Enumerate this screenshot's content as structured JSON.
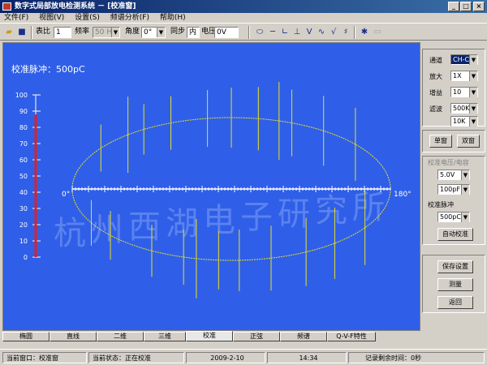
{
  "title": "数字式局部放电检测系统 － [校准窗]",
  "menu": [
    "文件(F)",
    "视图(V)",
    "设置(S)",
    "频谱分析(F)",
    "帮助(H)"
  ],
  "toolbar": {
    "biaobi_label": "表比",
    "biaobi_value": "1",
    "freq_label": "频率",
    "freq_value": "50 Hz",
    "angle_label": "角度",
    "angle_value": "0°",
    "sync_label": "同步",
    "sync_value": "内",
    "voltage_label": "电压",
    "voltage_value": "0V"
  },
  "scope": {
    "calib_title": "校准脉冲：500pC",
    "y_ticks": [
      "100",
      "90",
      "80",
      "70",
      "60",
      "50",
      "40",
      "30",
      "20",
      "10",
      "0"
    ],
    "left_angle": "0°",
    "right_angle": "180°",
    "watermark": "杭州西湖电子研究所",
    "level_bar_fraction": 0.88
  },
  "panel": {
    "channel_label": "通道",
    "channel_value": "CH-C",
    "gain_label": "放大",
    "gain_value": "1X",
    "boost_label": "增益",
    "boost_value": "10",
    "filter_label": "滤波",
    "filter_hi": "500K",
    "filter_lo": "10K",
    "single_btn": "单窗",
    "dual_btn": "双窗",
    "calib_group": "校准电压/电容",
    "calib_voltage": "5.0V",
    "calib_cap": "100pF",
    "calib_pulse_label": "校准脉冲",
    "calib_pulse_value": "500pC",
    "auto_calib_btn": "自动校准",
    "save_btn": "保存设置",
    "measure_btn": "测量",
    "back_btn": "返回"
  },
  "tabs": [
    "椭圆",
    "直线",
    "二维",
    "三维",
    "校准",
    "正弦",
    "频谱",
    "Q-V-F特性"
  ],
  "active_tab": "校准",
  "status": {
    "window": "当前窗口：校准窗",
    "state": "当前状态：正在校准",
    "date": "2009-2-10",
    "time": "14:34",
    "remaining": "记录剩余时间：0秒"
  }
}
